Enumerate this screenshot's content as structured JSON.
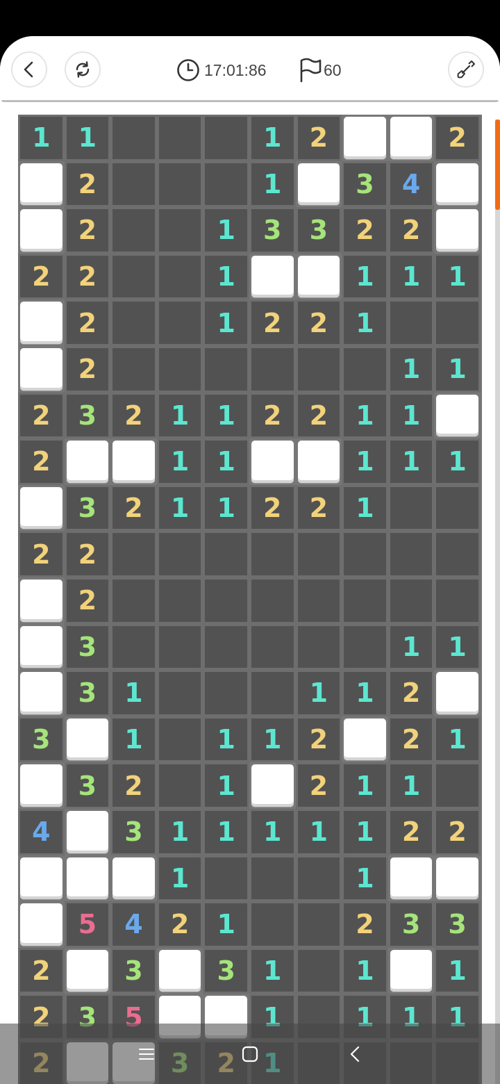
{
  "header": {
    "timer": "17:01:86",
    "flags": "60",
    "icons": {
      "back": "chevron-left-icon",
      "restart": "refresh-icon",
      "timer": "clock-icon",
      "flags": "flag-icon",
      "shovel": "shovel-icon"
    }
  },
  "colors": {
    "1": "#5ce6d0",
    "2": "#f2d27a",
    "3": "#a5e47a",
    "4": "#6aa9ec",
    "5": "#ea6d91",
    "accent": "#f26b15"
  },
  "board": {
    "columns": 10,
    "rows": [
      [
        "1",
        "1",
        "",
        "",
        "",
        "1",
        "2",
        "#",
        "#",
        "2"
      ],
      [
        "#",
        "2",
        "",
        "",
        "",
        "1",
        "#",
        "3",
        "4",
        "#"
      ],
      [
        "#",
        "2",
        "",
        "",
        "1",
        "3",
        "3",
        "2",
        "2",
        "#"
      ],
      [
        "2",
        "2",
        "",
        "",
        "1",
        "#",
        "#",
        "1",
        "1",
        "1"
      ],
      [
        "#",
        "2",
        "",
        "",
        "1",
        "2",
        "2",
        "1",
        "",
        ""
      ],
      [
        "#",
        "2",
        "",
        "",
        "",
        "",
        "",
        "",
        "1",
        "1"
      ],
      [
        "2",
        "3",
        "2",
        "1",
        "1",
        "2",
        "2",
        "1",
        "1",
        "#"
      ],
      [
        "2",
        "#",
        "#",
        "1",
        "1",
        "#",
        "#",
        "1",
        "1",
        "1"
      ],
      [
        "#",
        "3",
        "2",
        "1",
        "1",
        "2",
        "2",
        "1",
        "",
        ""
      ],
      [
        "2",
        "2",
        "",
        "",
        "",
        "",
        "",
        "",
        "",
        ""
      ],
      [
        "#",
        "2",
        "",
        "",
        "",
        "",
        "",
        "",
        "",
        ""
      ],
      [
        "#",
        "3",
        "",
        "",
        "",
        "",
        "",
        "",
        "1",
        "1"
      ],
      [
        "#",
        "3",
        "1",
        "",
        "",
        "",
        "1",
        "1",
        "2",
        "#"
      ],
      [
        "3",
        "#",
        "1",
        "",
        "1",
        "1",
        "2",
        "#",
        "2",
        "1"
      ],
      [
        "#",
        "3",
        "2",
        "",
        "1",
        "#",
        "2",
        "1",
        "1",
        ""
      ],
      [
        "4",
        "#",
        "3",
        "1",
        "1",
        "1",
        "1",
        "1",
        "2",
        "2"
      ],
      [
        "#",
        "#",
        "#",
        "1",
        "",
        "",
        "",
        "1",
        "#",
        "#"
      ],
      [
        "#",
        "5",
        "4",
        "2",
        "1",
        "",
        "",
        "2",
        "3",
        "3"
      ],
      [
        "2",
        "#",
        "3",
        "#",
        "3",
        "1",
        "",
        "1",
        "#",
        "1"
      ],
      [
        "2",
        "3",
        "5",
        "#",
        "#",
        "1",
        "",
        "1",
        "1",
        "1"
      ],
      [
        "2",
        "#",
        "#",
        "3",
        "2",
        "1",
        "",
        "",
        "",
        ""
      ]
    ]
  },
  "navbar": {
    "icons": [
      "menu-icon",
      "home-icon",
      "back-icon"
    ]
  }
}
